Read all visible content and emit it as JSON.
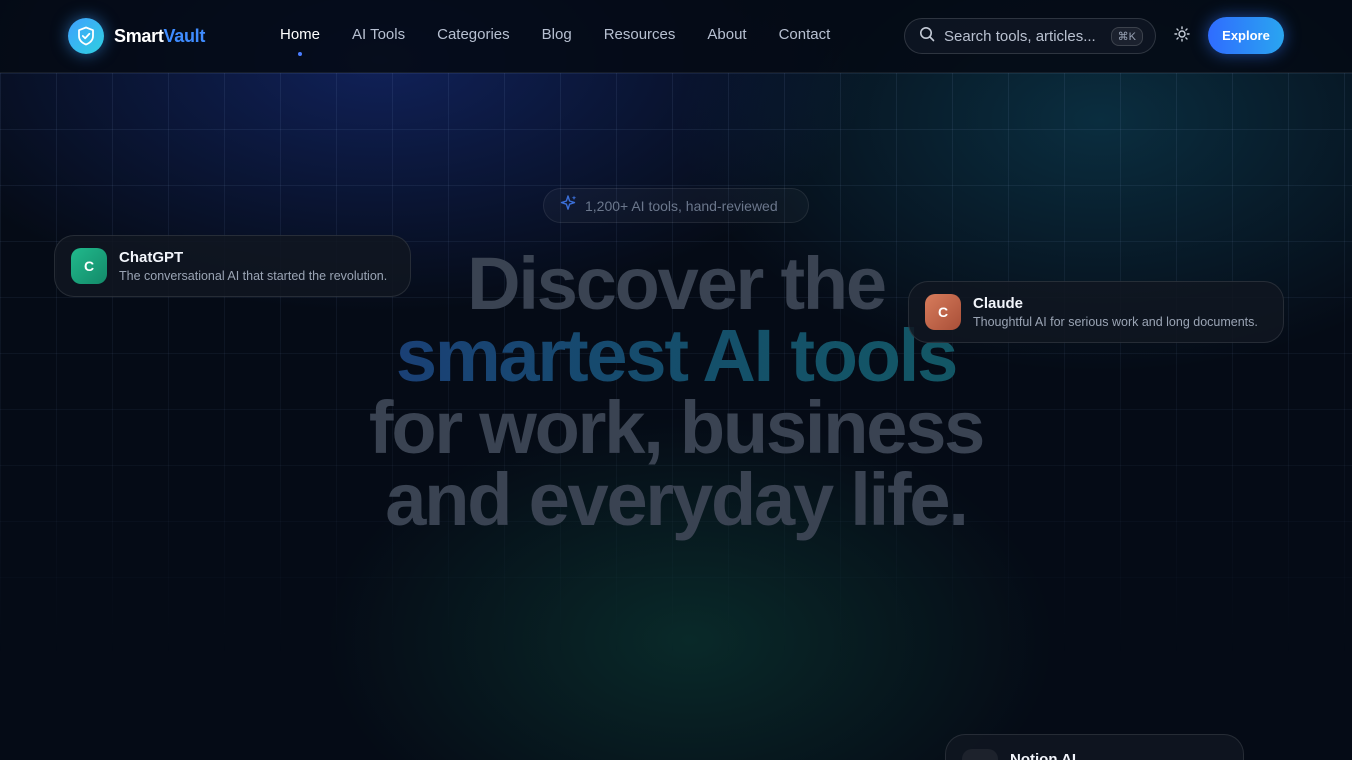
{
  "brand": {
    "name_part1": "Smart",
    "name_part2": "Vault",
    "logo_icon": "shield-check-icon"
  },
  "nav": {
    "items": [
      {
        "label": "Home",
        "active": true
      },
      {
        "label": "AI Tools",
        "active": false
      },
      {
        "label": "Categories",
        "active": false
      },
      {
        "label": "Blog",
        "active": false
      },
      {
        "label": "Resources",
        "active": false
      },
      {
        "label": "About",
        "active": false
      },
      {
        "label": "Contact",
        "active": false
      }
    ]
  },
  "search": {
    "placeholder": "Search tools, articles...",
    "shortcut": "⌘K",
    "icon": "search-icon"
  },
  "theme_toggle": {
    "icon": "sun-icon"
  },
  "cta": {
    "label": "Explore"
  },
  "hero": {
    "badge": {
      "icon": "sparkles-icon",
      "text": "1,200+ AI tools, hand-reviewed"
    },
    "headline": {
      "line1": "Discover the",
      "line2": "smartest AI tools",
      "line3": "for work, business",
      "line4": "and everyday life."
    }
  },
  "floating_cards": [
    {
      "initial": "C",
      "title": "ChatGPT",
      "description": "The conversational AI that started the revolution.",
      "color": "#1aa07a"
    },
    {
      "initial": "C",
      "title": "Claude",
      "description": "Thoughtful AI for serious work and long documents.",
      "color": "#c0664a"
    },
    {
      "initial": "",
      "title": "Notion AI",
      "description": "",
      "color": "#222833"
    }
  ],
  "colors": {
    "accent": "#3f8cff",
    "background": "#050b16",
    "cta_gradient_start": "#2f6cff",
    "cta_gradient_end": "#2aa5f0"
  }
}
